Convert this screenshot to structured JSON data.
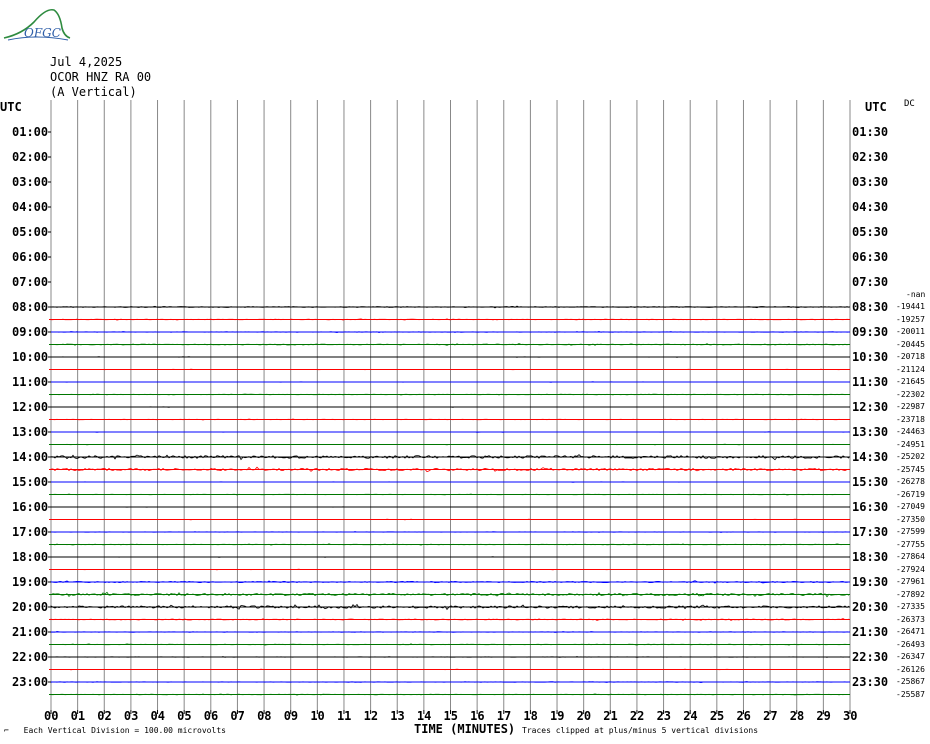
{
  "logo_text": "OFGC",
  "header": {
    "date": "Jul 4,2025",
    "station": "OCOR HNZ RA 00",
    "component": "(A Vertical)"
  },
  "utc_left": "UTC",
  "utc_right": "UTC",
  "dc_label": "DC",
  "footer": {
    "vertical_division": "Each Vertical Division =  100.00 microvolts",
    "xlabel": "TIME (MINUTES)",
    "clip_note": "Traces clipped at plus/minus 5 vertical divisions"
  },
  "colors": {
    "trace_cycle": [
      "#000000",
      "#ff0000",
      "#0000ff",
      "#007700"
    ],
    "grid": "#000000"
  },
  "chart_data": {
    "type": "line",
    "title": "",
    "xlabel": "TIME (MINUTES)",
    "xlim": [
      0,
      30
    ],
    "x_ticks": [
      "00",
      "01",
      "02",
      "03",
      "04",
      "05",
      "06",
      "07",
      "08",
      "09",
      "10",
      "11",
      "12",
      "13",
      "14",
      "15",
      "16",
      "17",
      "18",
      "19",
      "20",
      "21",
      "22",
      "23",
      "24",
      "25",
      "26",
      "27",
      "28",
      "29",
      "30"
    ],
    "left_labels": [
      "01:00",
      "02:00",
      "03:00",
      "04:00",
      "05:00",
      "06:00",
      "07:00",
      "08:00",
      "09:00",
      "10:00",
      "11:00",
      "12:00",
      "13:00",
      "14:00",
      "15:00",
      "16:00",
      "17:00",
      "18:00",
      "19:00",
      "20:00",
      "21:00",
      "22:00",
      "23:00"
    ],
    "right_labels": [
      "01:30",
      "02:30",
      "03:30",
      "04:30",
      "05:30",
      "06:30",
      "07:30",
      "08:30",
      "09:30",
      "10:30",
      "11:30",
      "12:30",
      "13:30",
      "14:30",
      "15:30",
      "16:30",
      "17:30",
      "18:30",
      "19:30",
      "20:30",
      "21:30",
      "22:30",
      "23:30"
    ],
    "first_trace_row": 16,
    "dc_first": "-nan",
    "dc_offsets": [
      "-19441",
      "-19257",
      "-20011",
      "-20445",
      "-20718",
      "-21124",
      "-21645",
      "-22302",
      "-22987",
      "-23718",
      "-24463",
      "-24951",
      "-25202",
      "-25745",
      "-26278",
      "-26719",
      "-27049",
      "-27350",
      "-27599",
      "-27755",
      "-27864",
      "-27924",
      "-27961",
      "-27892",
      "-27335",
      "-26373",
      "-26471",
      "-26493",
      "-26347",
      "-26126",
      "-25867",
      "-25587"
    ],
    "trace_count": 32,
    "noise_profile": [
      0.3,
      0.2,
      0.2,
      0.3,
      0.1,
      0.1,
      0.1,
      0.2,
      0.1,
      0.15,
      0.1,
      0.1,
      0.9,
      0.7,
      0.1,
      0.15,
      0.1,
      0.1,
      0.15,
      0.2,
      0.1,
      0.1,
      0.4,
      0.7,
      0.8,
      0.3,
      0.2,
      0.2,
      0.15,
      0.1,
      0.2,
      0.2
    ]
  }
}
